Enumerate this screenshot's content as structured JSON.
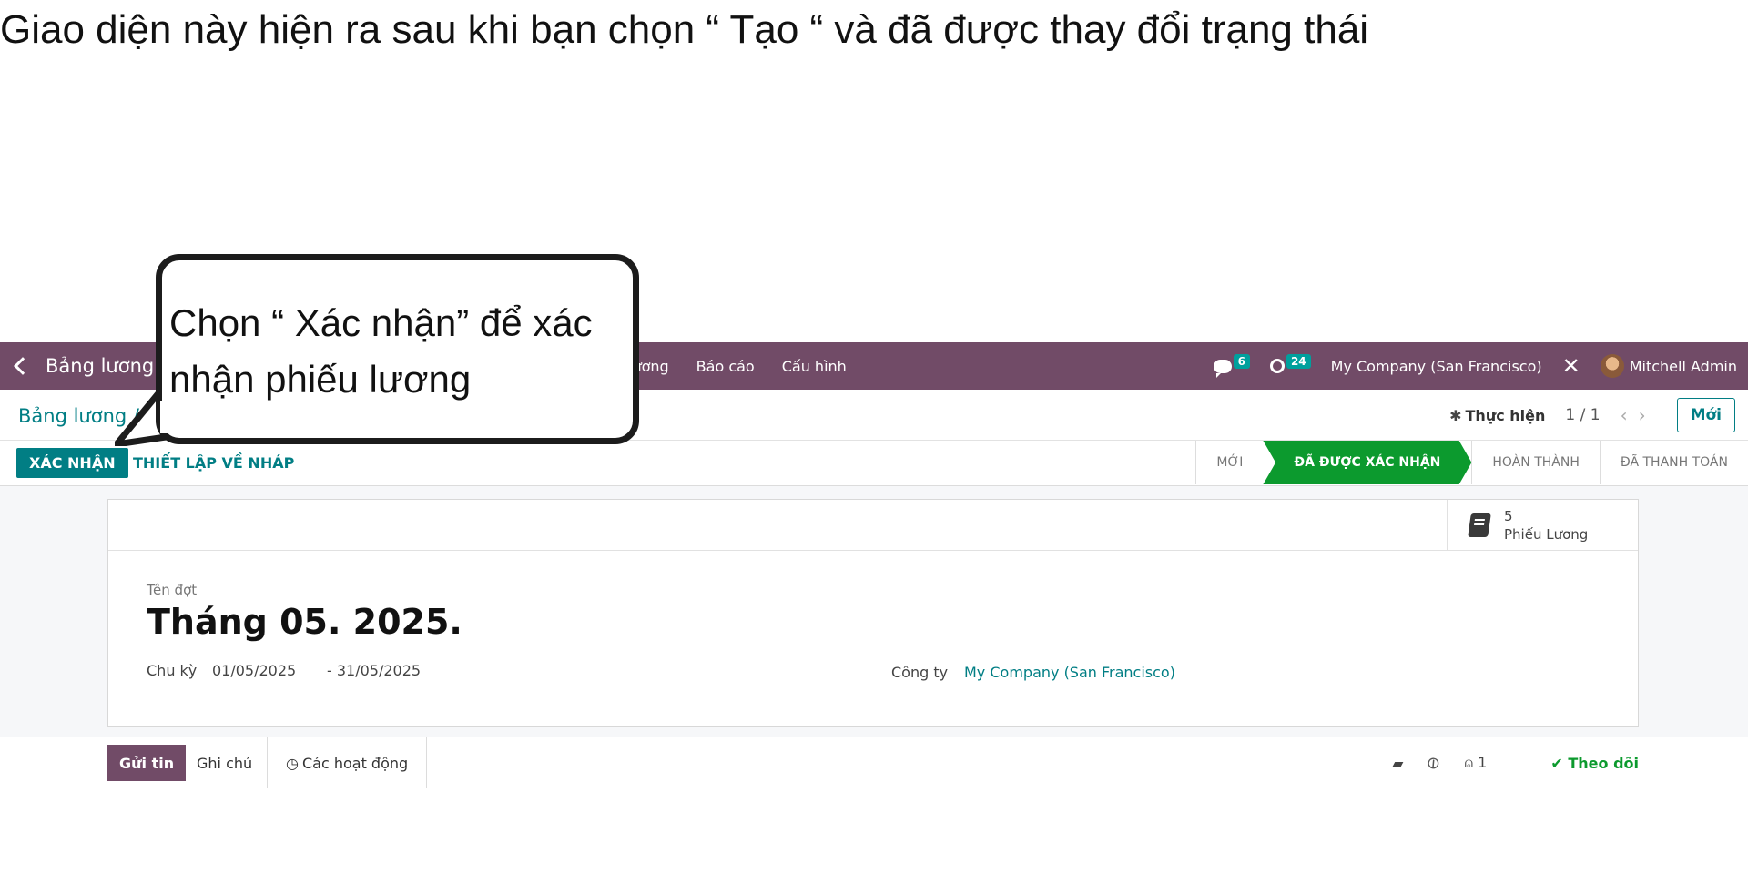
{
  "slide": {
    "heading": "Giao diện  này hiện ra sau khi  bạn chọn “ Tạo “ và đã được thay đổi trạng thái",
    "callout_text": "Chọn “ Xác nhận” để xác nhận phiếu lương"
  },
  "navbar": {
    "app_name": "Bảng lương",
    "menu": [
      "lương",
      "Báo cáo",
      "Cấu hình"
    ],
    "messages_count": "6",
    "activities_count": "24",
    "company": "My Company (San Francisco)",
    "user": "Mitchell Admin"
  },
  "control_panel": {
    "breadcrumb": "Bảng lương /",
    "action_label": "Thực hiện",
    "pager": "1 / 1",
    "new_button": "Mới"
  },
  "statusbar": {
    "confirm_button": "XÁC NHẬN",
    "draft_button": "THIẾT LẬP VỀ NHÁP",
    "stages": [
      {
        "label": "MỚI",
        "active": false
      },
      {
        "label": "ĐÃ ĐƯỢC XÁC NHẬN",
        "active": true
      },
      {
        "label": "HOÀN THÀNH",
        "active": false
      },
      {
        "label": "ĐÃ THANH TOÁN",
        "active": false
      }
    ]
  },
  "form": {
    "smart_button": {
      "count": "5",
      "label": "Phiếu Lương"
    },
    "batch_label": "Tên đợt",
    "batch_name": "Tháng 05. 2025.",
    "period_label": "Chu kỳ",
    "period_from": "01/05/2025",
    "period_to": "- 31/05/2025",
    "company_label": "Công ty",
    "company_value": "My Company (San Francisco)"
  },
  "chatter": {
    "send_message": "Gửi tin",
    "log_note": "Ghi chú",
    "activities": "Các hoạt động",
    "followers_count": "1",
    "follow": "Theo dõi"
  },
  "colors": {
    "navbar": "#714b67",
    "primary": "#017e84",
    "active_stage": "#0c9a2e"
  }
}
